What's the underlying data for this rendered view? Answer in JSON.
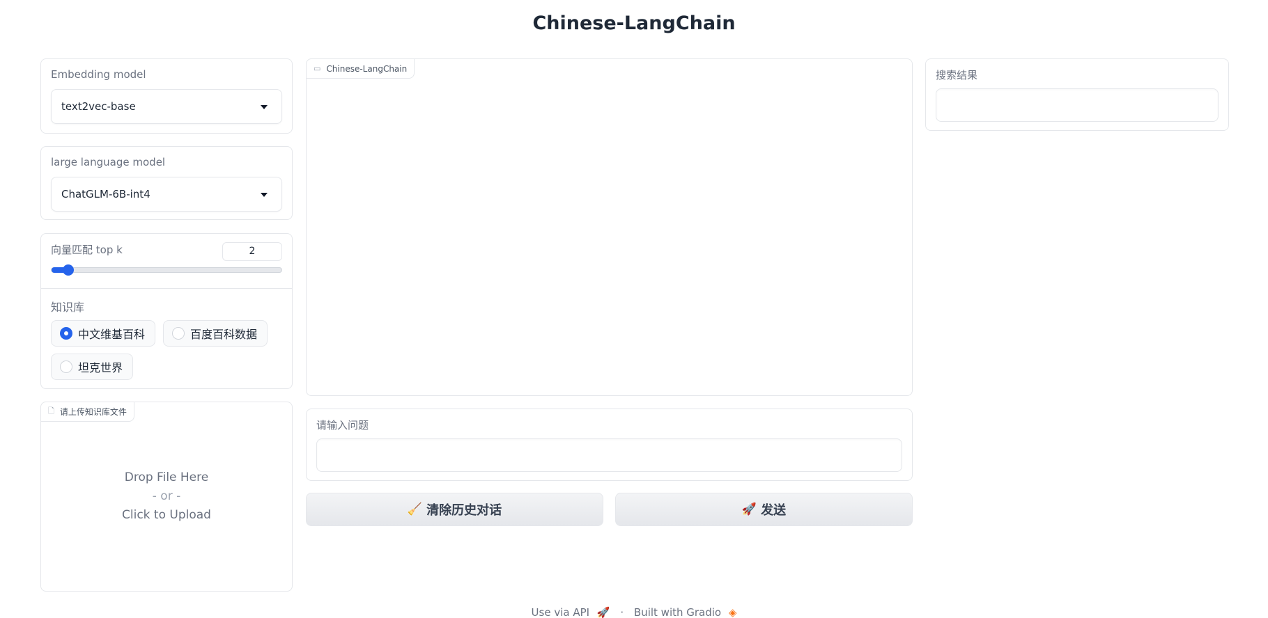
{
  "app": {
    "title": "Chinese-LangChain"
  },
  "left": {
    "embedding": {
      "label": "Embedding model",
      "value": "text2vec-base"
    },
    "llm": {
      "label": "large language model",
      "value": "ChatGLM-6B-int4"
    },
    "topk": {
      "label": "向量匹配 top k",
      "value": "2",
      "slider_fraction": 0.0
    },
    "kb": {
      "label": "知识库",
      "options": [
        {
          "label": "中文维基百科",
          "selected": true
        },
        {
          "label": "百度百科数据",
          "selected": false
        },
        {
          "label": "坦克世界",
          "selected": false
        }
      ]
    },
    "upload": {
      "tab_label": "请上传知识库文件",
      "drop": "Drop File Here",
      "or": "- or -",
      "click": "Click to Upload"
    }
  },
  "center": {
    "chat": {
      "tab_label": "Chinese-LangChain"
    },
    "question": {
      "label": "请输入问题",
      "value": ""
    },
    "clear_button": {
      "emoji": "🧹",
      "label": "清除历史对话"
    },
    "send_button": {
      "emoji": "🚀",
      "label": "发送"
    }
  },
  "right": {
    "search": {
      "label": "搜索结果",
      "value": ""
    }
  },
  "footer": {
    "api": "Use via API",
    "separator": "·",
    "built": "Built with Gradio"
  },
  "colors": {
    "accent": "#2563eb",
    "border": "#e5e7eb",
    "brand_orange": "#f97316"
  },
  "icons": {
    "chat_tab": "chat-bubble-icon",
    "upload_tab": "file-icon",
    "api": "rocket-icon",
    "gradio": "gradio-logo-icon"
  }
}
